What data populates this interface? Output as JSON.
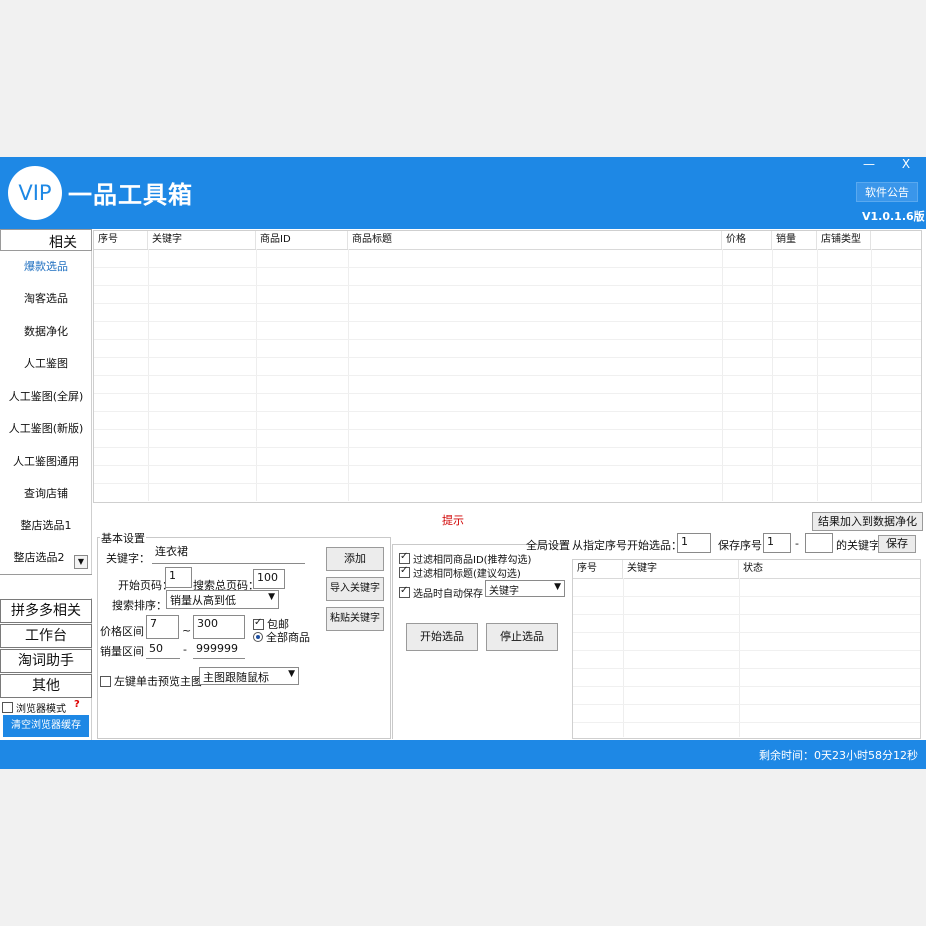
{
  "app": {
    "logo": "VIP",
    "title": "一品工具箱",
    "minimize": "—",
    "close": "X",
    "notice_button": "软件公告",
    "version": "V1.0.1.6版"
  },
  "sidebar": {
    "header": "相关",
    "items": [
      "爆款选品",
      "淘客选品",
      "数据净化",
      "人工鉴图",
      "人工鉴图(全屏)",
      "人工鉴图(新版)",
      "人工鉴图通用",
      "查询店铺",
      "整店选品1",
      "整店选品2"
    ],
    "categories": [
      "拼多多相关",
      "工作台",
      "淘词助手",
      "其他"
    ],
    "browser_mode": "浏览器模式",
    "help": "?",
    "clear_cache": "清空浏览器缓存"
  },
  "main_table": {
    "columns": [
      "序号",
      "关键字",
      "商品ID",
      "商品标题",
      "价格",
      "销量",
      "店铺类型"
    ]
  },
  "tip": "提示",
  "add_to_cleaning": "结果加入到数据净化",
  "basic": {
    "title": "基本设置",
    "keyword_label": "关键字：",
    "keyword_value": "连衣裙",
    "start_page_label": "开始页码：",
    "start_page_value": "1",
    "total_pages_label": "搜索总页码：",
    "total_pages_value": "100",
    "sort_label": "搜索排序：",
    "sort_value": "销量从高到低",
    "price_label": "价格区间：",
    "price_min": "7",
    "price_sep": "~",
    "price_max": "300",
    "free_shipping": "包邮",
    "all_goods": "全部商品",
    "sales_label": "销量区间：",
    "sales_min": "50",
    "sales_sep": "-",
    "sales_max": "999999",
    "left_click_preview": "左键单击预览主图",
    "image_mode": "主图跟随鼠标",
    "add_button": "添加",
    "import_button": "导入关键字",
    "paste_button": "粘贴关键字"
  },
  "global": {
    "title": "全局设置",
    "filter_id": "过滤相同商品ID(推荐勾选)",
    "filter_title": "过滤相同标题(建议勾选)",
    "auto_save": "选品时自动保存",
    "auto_save_mode": "关键字",
    "start_button": "开始选品",
    "stop_button": "停止选品"
  },
  "right": {
    "from_index_label": "从指定序号开始选品：",
    "from_index_value": "1",
    "save_index_label": "保存序号：",
    "save_index_from": "1",
    "save_index_sep": "-",
    "save_index_to": "",
    "keyword_suffix": "的关键字",
    "save_button": "保存",
    "columns": [
      "序号",
      "关键字",
      "状态"
    ]
  },
  "status": {
    "remaining": "剩余时间：0天23小时58分12秒"
  }
}
